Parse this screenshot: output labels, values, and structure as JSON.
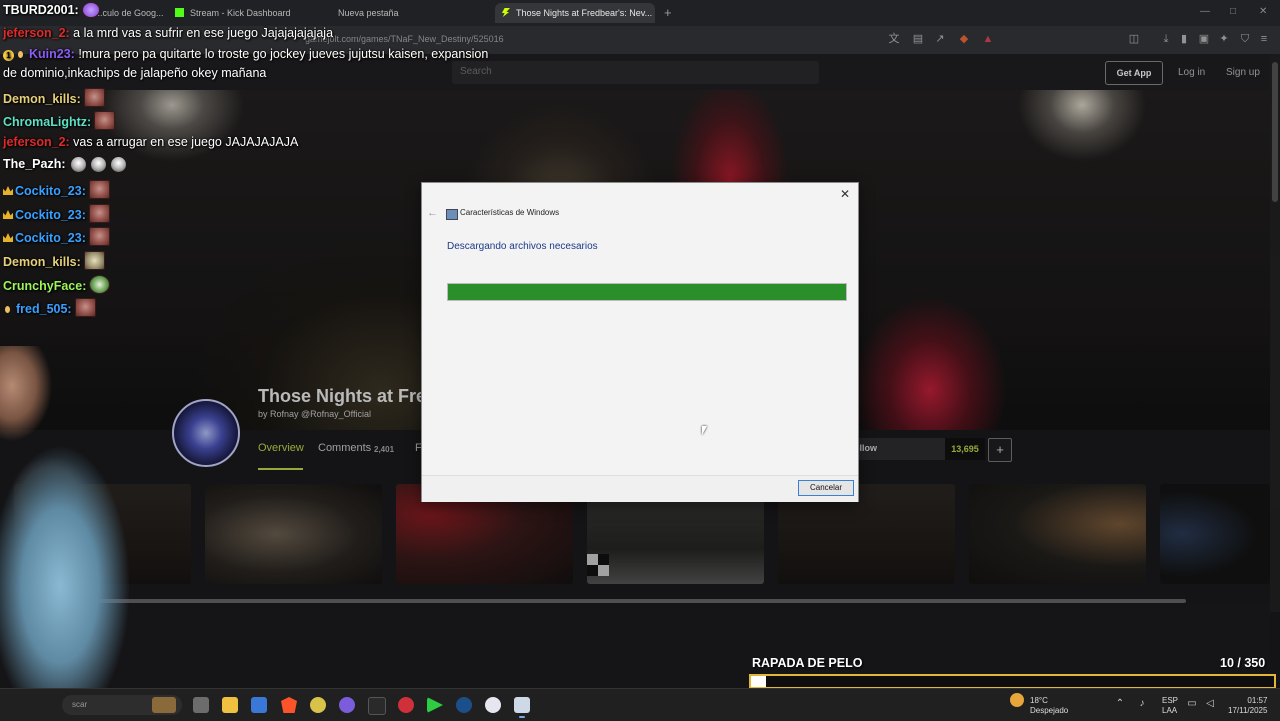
{
  "browser": {
    "tabs": [
      {
        "label": "...culo de Goog..."
      },
      {
        "label": "Stream - Kick Dashboard"
      },
      {
        "label": "Nueva pestaña"
      },
      {
        "label": "Those Nights at Fredbear's: Nev..."
      }
    ],
    "new_tab": "+",
    "url": "gamejolt.com/games/TNaF_New_Destiny/525016",
    "minimize": "—",
    "maximize": "□",
    "close": "✕"
  },
  "site": {
    "search_placeholder": "Search",
    "get_app": "Get App",
    "login": "Log in",
    "signup": "Sign up",
    "game_title": "Those Nights at Fre",
    "game_by": "by Rofnay @Rofnay_Official",
    "tabs": {
      "overview": "Overview",
      "comments": "Comments",
      "comments_count": "2,401",
      "f": "F"
    },
    "follow_label": "ollow",
    "follow_count": "13,695",
    "plus": "+"
  },
  "dialog": {
    "title": "Características de Windows",
    "heading": "Descargando archivos necesarios",
    "progress_percent": 100,
    "cancel": "Cancelar",
    "close": "✕",
    "back": "←"
  },
  "chat": [
    {
      "user": "TBURD2001:",
      "color": "#ffffff",
      "message": ""
    },
    {
      "user": "jeferson_2:",
      "color": "#e12b2b",
      "message": " a la mrd vas a sufrir en ese juego Jajajajajajaja"
    },
    {
      "user": "Kuin23:",
      "color": "#8b5cf6",
      "message": " !mura pero pa quitarte lo troste go jockey jueves jujutsu kaisen, expansion"
    },
    {
      "user": "",
      "color": "#ffffff",
      "message": "de dominio,inkachips de jalapeño okey mañana"
    },
    {
      "user": "Demon_kills:",
      "color": "#e6d07a",
      "message": ""
    },
    {
      "user": "ChromaLightz:",
      "color": "#5ee0c4",
      "message": ""
    },
    {
      "user": "jeferson_2:",
      "color": "#e12b2b",
      "message": " vas a arrugar en ese juego JAJAJAJAJA"
    },
    {
      "user": "The_Pazh:",
      "color": "#ffffff",
      "message": ""
    },
    {
      "user": "Cockito_23:",
      "color": "#3aa0ff",
      "message": ""
    },
    {
      "user": "Cockito_23:",
      "color": "#3aa0ff",
      "message": ""
    },
    {
      "user": "Cockito_23:",
      "color": "#3aa0ff",
      "message": ""
    },
    {
      "user": "Demon_kills:",
      "color": "#e6d07a",
      "message": ""
    },
    {
      "user": "CrunchyFace:",
      "color": "#9df55a",
      "message": ""
    },
    {
      "user": "fred_505:",
      "color": "#3aa0ff",
      "message": ""
    }
  ],
  "goal": {
    "title": "RAPADA DE PELO",
    "current": "10",
    "total": "/ 350",
    "fraction": 0.0286
  },
  "taskbar": {
    "search": "scar",
    "weather_temp": "18°C",
    "weather_desc": "Despejado",
    "lang1": "ESP",
    "lang2": "LAA",
    "time": "01:57",
    "date": "17/11/2025"
  }
}
